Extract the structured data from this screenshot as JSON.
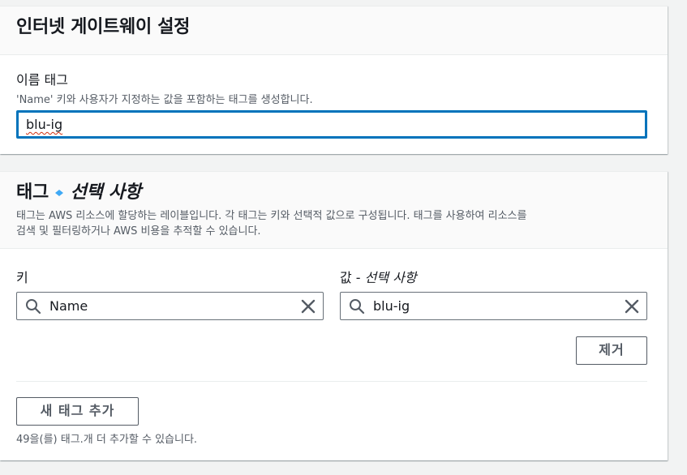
{
  "panel1": {
    "title": "인터넷 게이트웨이 설정",
    "name_tag": {
      "label": "이름 태그",
      "description": "'Name' 키와 사용자가 지정하는 값을 포함하는 태그를 생성합니다.",
      "value": "blu-ig"
    }
  },
  "panel2": {
    "title_main": "태그",
    "title_optional": "선택 사항",
    "description_line1": "태그는 AWS 리소스에 할당하는 레이블입니다. 각 태그는 키와 선택적 값으로 구성됩니다. 태그를 사용하여 리소스를",
    "description_line2": "검색 및 필터링하거나 AWS 비용을 추적할 수 있습니다.",
    "key_label": "키",
    "value_label_prefix": "값 - ",
    "value_label_optional": "선택 사항",
    "key_value": "Name",
    "value_value": "blu-ig",
    "remove_button": "제거",
    "add_tag_button": "새 태그 추가",
    "remaining_note": "49을(를) 태그.개 더 추가할 수 있습니다."
  },
  "icons": {
    "search": "search-icon",
    "clear": "close-icon"
  },
  "colors": {
    "focus_border": "#0073bb",
    "button_border": "#545b64",
    "page_background": "#f2f3f3"
  }
}
